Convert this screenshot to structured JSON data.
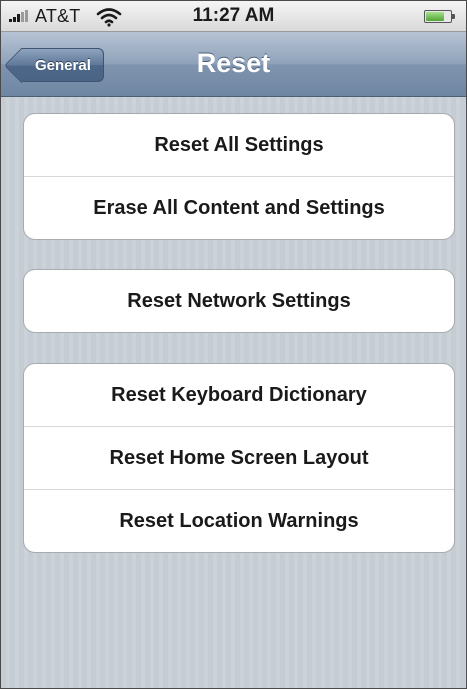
{
  "status_bar": {
    "carrier": "AT&T",
    "time": "11:27 AM",
    "signal_icon": "signal-bars-icon",
    "wifi_icon": "wifi-icon",
    "battery_icon": "battery-icon",
    "battery_level": 0.75
  },
  "nav": {
    "back_label": "General",
    "title": "Reset"
  },
  "groups": [
    {
      "items": [
        "Reset All Settings",
        "Erase All Content and Settings"
      ]
    },
    {
      "items": [
        "Reset Network Settings"
      ]
    },
    {
      "items": [
        "Reset Keyboard Dictionary",
        "Reset Home Screen Layout",
        "Reset Location Warnings"
      ]
    }
  ],
  "colors": {
    "nav_blue": "#7f94ae",
    "background_stripe": "#c5ccd4",
    "battery_green": "#4fa636"
  }
}
